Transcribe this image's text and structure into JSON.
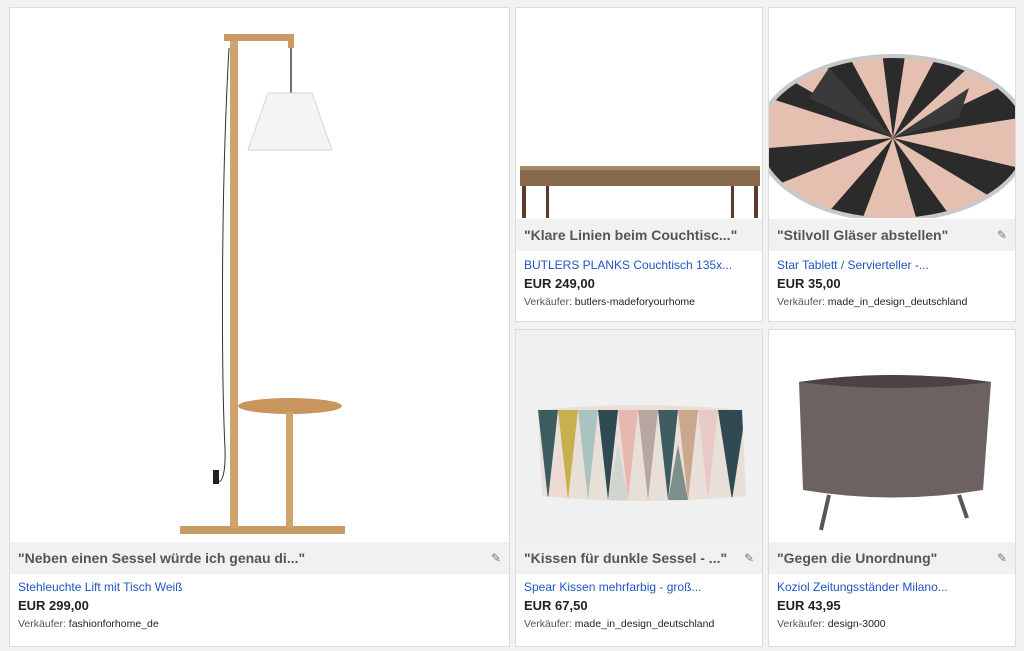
{
  "cards": [
    {
      "quote": "\"Neben einen Sessel würde ich genau di...\"",
      "title": "Stehleuchte Lift mit Tisch Weiß",
      "price": "EUR 299,00",
      "seller_label": "Verkäufer:",
      "seller": "fashionforhome_de"
    },
    {
      "quote": "\"Klare Linien beim Couchtisc...\"",
      "title": "BUTLERS PLANKS Couchtisch 135x...",
      "price": "EUR 249,00",
      "seller_label": "Verkäufer:",
      "seller": "butlers-madeforyourhome"
    },
    {
      "quote": "\"Stilvoll Gläser abstellen\"",
      "title": "Star Tablett / Servierteller -...",
      "price": "EUR 35,00",
      "seller_label": "Verkäufer:",
      "seller": "made_in_design_deutschland"
    },
    {
      "quote": "\"Kissen für dunkle Sessel - ...\"",
      "title": "Spear Kissen mehrfarbig - groß...",
      "price": "EUR 67,50",
      "seller_label": "Verkäufer:",
      "seller": "made_in_design_deutschland"
    },
    {
      "quote": "\"Gegen die Unordnung\"",
      "title": "Koziol Zeitungsständer Milano...",
      "price": "EUR 43,95",
      "seller_label": "Verkäufer:",
      "seller": "design-3000"
    }
  ],
  "icons": {
    "edit": "pencil-icon"
  }
}
